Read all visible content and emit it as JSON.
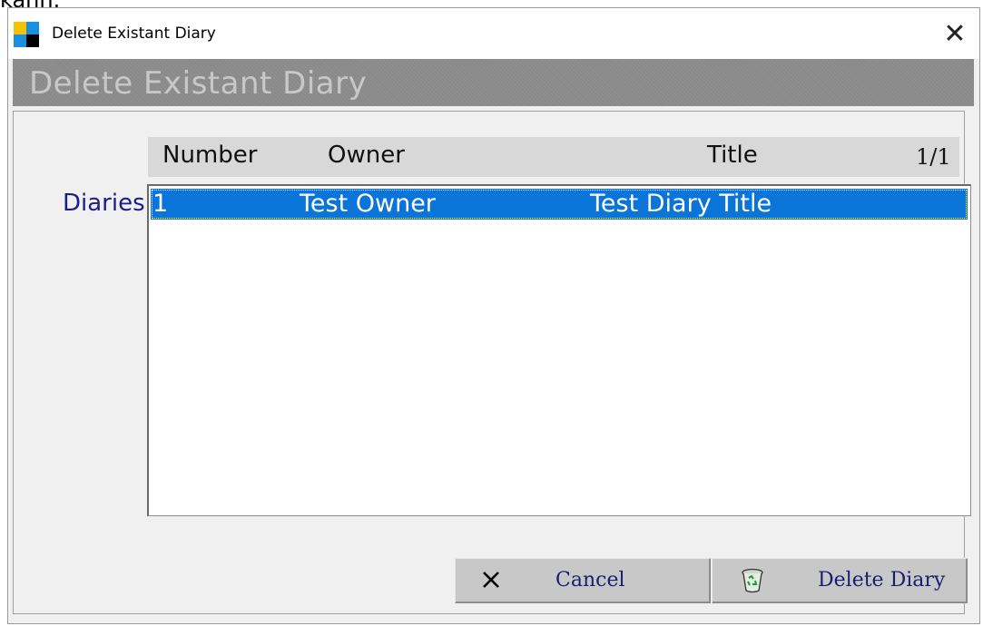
{
  "background_text": "kann.",
  "window": {
    "title": "Delete Existant Diary",
    "close_glyph": "✕"
  },
  "header": {
    "title": "Delete Existant Diary"
  },
  "list": {
    "label": "Diaries",
    "columns": [
      "Number",
      "Owner",
      "Title"
    ],
    "pager": "1/1",
    "rows": [
      {
        "number": "1",
        "owner": "Test Owner",
        "title": "Test Diary Title",
        "selected": true
      }
    ]
  },
  "buttons": {
    "cancel": {
      "label": "Cancel",
      "icon": "x-icon"
    },
    "delete": {
      "label": "Delete Diary",
      "icon": "recycle-bin-icon"
    }
  },
  "colors": {
    "selection": "#0a74d9",
    "header_bar": "#8a8a8a",
    "label_text": "#1c1c8c"
  }
}
